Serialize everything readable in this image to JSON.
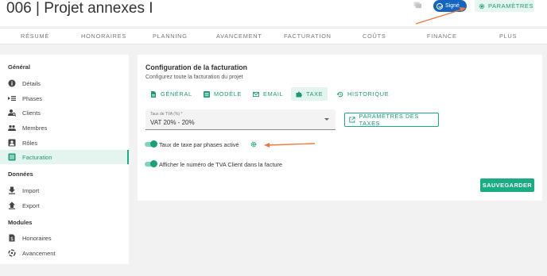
{
  "header": {
    "project_title": "006 | Projet annexes I",
    "status_badge": "Signé",
    "params_button": "PARAMÈTRES"
  },
  "nav": [
    "RÉSUMÉ",
    "HONORAIRES",
    "PLANNING",
    "AVANCEMENT",
    "FACTURATION",
    "COÛTS",
    "FINANCE",
    "PLUS"
  ],
  "sidebar": {
    "sections": [
      {
        "title": "Général",
        "items": [
          "Détails",
          "Phases",
          "Clients",
          "Membres",
          "Rôles",
          "Facturation"
        ]
      },
      {
        "title": "Données",
        "items": [
          "Import",
          "Export"
        ]
      },
      {
        "title": "Modules",
        "items": [
          "Honoraires",
          "Avancement"
        ]
      }
    ],
    "active_item": "Facturation"
  },
  "main": {
    "title": "Configuration de la facturation",
    "subtitle": "Configurez toute la facturation du projet",
    "tabs": [
      "GÉNÉRAL",
      "MODÈLE",
      "EMAIL",
      "TAXE",
      "HISTORIQUE"
    ],
    "active_tab": "TAXE",
    "tva_select": {
      "label": "Taux de TVA (%) *",
      "value": "VAT 20% - 20%"
    },
    "taxes_button": "PARAMÈTRES DES TAXES",
    "toggles": [
      {
        "label": "Taux de taxe par phases activé",
        "on": true
      },
      {
        "label": "Afficher le numéro de TVA Client dans la facture",
        "on": true
      }
    ],
    "save_button": "SAUVEGARDER"
  },
  "colors": {
    "accent": "#1aad85",
    "accent_light": "#e3f5ee",
    "badge_blue": "#1565c0",
    "annotation_arrow": "#f07a3c"
  }
}
